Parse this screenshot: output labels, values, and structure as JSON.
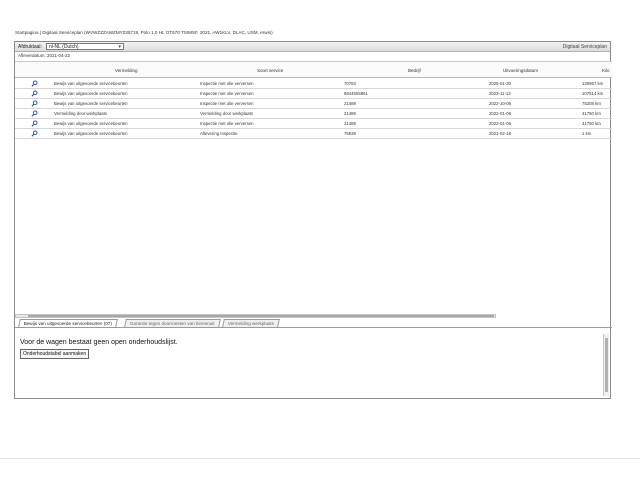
{
  "breadcrumb": "Startpagina | Digitaal Serviceplan (WVWZZZAWZMY035719, Polo 1.0 HL OT570 TSIMSF, 2021, AW1KLV, DLAC, USM, erwin)",
  "toolbar": {
    "language_label": "Afdruktaal:",
    "language_value": "nl-NL (Dutch)",
    "app_title": "Digitaal Serviceplan"
  },
  "date_line": "Afleverdatum: 2021-04-22",
  "grid": {
    "headers": [
      "Vermelding",
      "Soort service",
      "Bedrijf",
      "Uitvoeringsdatum",
      "Kilo"
    ],
    "rows": [
      {
        "vermelding": "Bewijs van uitgevoerde serviceb­eurten",
        "soort": "Inspectie met olie verversen",
        "bedrijf": "70783",
        "datum": "2025-01-30",
        "km": "130967 km"
      },
      {
        "vermelding": "Bewijs van uitgevoerde servicebeurten",
        "soort": "Inspectie met olie verversen",
        "bedrijf": "8844555861",
        "datum": "2023-11-13",
        "km": "107514 km"
      },
      {
        "vermelding": "Bewijs van uitgevoerde servicebeurten",
        "soort": "Inspectie met olie verversen",
        "bedrijf": "21489",
        "datum": "2022-10-06",
        "km": "75208 km"
      },
      {
        "vermelding": "Vermelding door werkplaats",
        "soort": "Vermelding door werkplaats",
        "bedrijf": "21489",
        "datum": "2022-01-06",
        "km": "41750 km"
      },
      {
        "vermelding": "Bewijs van uitgevoerde servicebeurten",
        "soort": "Inspectie met olie verversen",
        "bedrijf": "21489",
        "datum": "2022-01-06",
        "km": "41750 km"
      },
      {
        "vermelding": "Bewijs van uitgevoerde servicebeurten",
        "soort": "Aflevering Inspectie",
        "bedrijf": "75839",
        "datum": "2021-02-18",
        "km": "1 km"
      }
    ]
  },
  "tabs": [
    {
      "label": "Bewijs van uitgevoerde servicebeurten (07)",
      "active": true
    },
    {
      "label": "Garantie tegen doorroesten van binnenuit",
      "active": false
    },
    {
      "label": "Vermelding werkplaats",
      "active": false
    }
  ],
  "panel": {
    "message": "Voor de wagen bestaat geen open onderhoudslijst.",
    "button_label": "Onderhoudstabel aanmaken"
  },
  "colors": {
    "border": "#8c8c8c",
    "icon": "#2a5db0",
    "tab_active": "#ffffff"
  }
}
